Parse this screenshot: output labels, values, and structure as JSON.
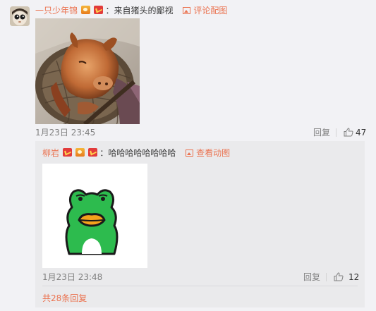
{
  "comment": {
    "username": "一只少年锦",
    "text": "：来自猪头的鄙视",
    "pic_link": "评论配图",
    "time": "1月23日 23:45",
    "reply_label": "回复",
    "likes": "47"
  },
  "reply": {
    "username": "柳岩",
    "text": "：哈哈哈哈哈哈哈哈",
    "pic_link": "查看动图",
    "time": "1月23日 23:48",
    "reply_label": "回复",
    "likes": "12"
  },
  "more_replies": "共28条回复",
  "colors": {
    "accent": "#eb7350",
    "meta": "#808080",
    "sub_box": "#eaeaec",
    "frog_green": "#2dbb4e"
  }
}
